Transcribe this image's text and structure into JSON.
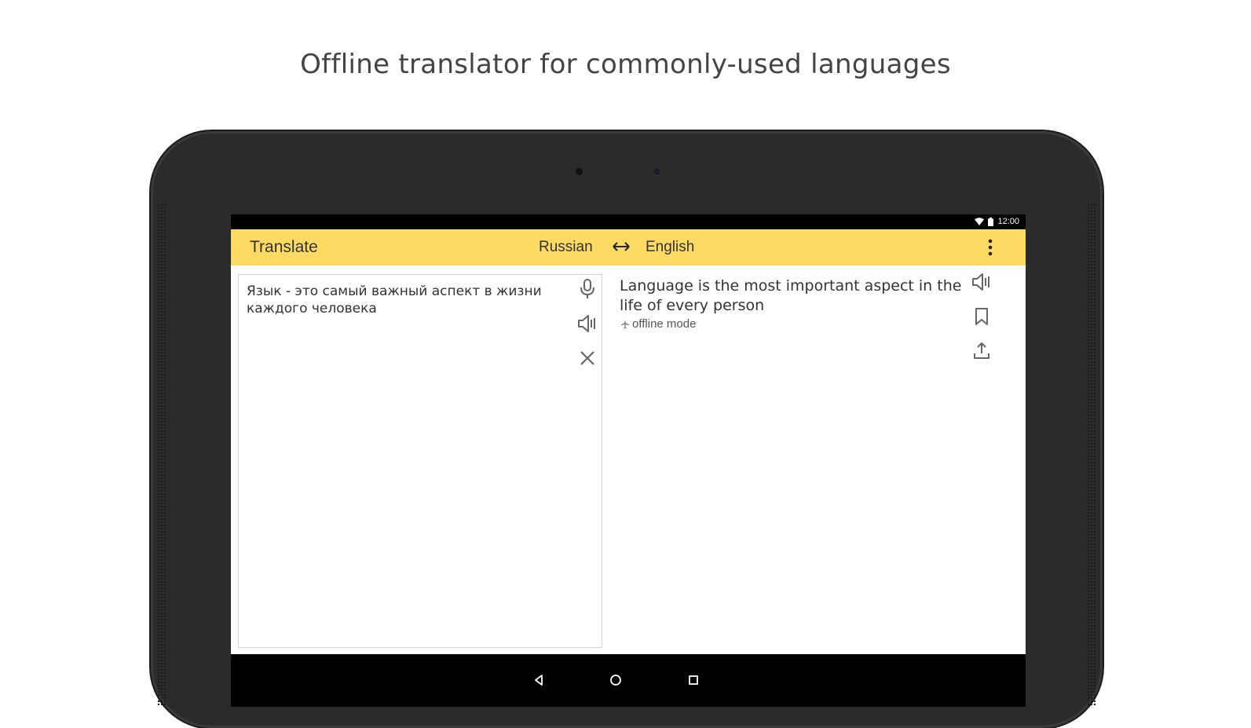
{
  "headline": "Offline translator for commonly-used languages",
  "status_bar": {
    "time": "12:00",
    "wifi_icon": "wifi-icon",
    "battery_icon": "battery-icon"
  },
  "toolbar": {
    "title": "Translate",
    "source_language": "Russian",
    "target_language": "English",
    "swap_icon": "swap-arrows-icon",
    "menu_icon": "overflow-menu-icon",
    "background_color": "#fddb63"
  },
  "input": {
    "text": "Язык - это самый важный аспект в жизни каждого человека",
    "icons": [
      "microphone-icon",
      "speaker-icon",
      "close-icon"
    ]
  },
  "output": {
    "text": "Language is the most important aspect in the life of every person",
    "mode_label": "offline mode",
    "icons": [
      "speaker-icon",
      "bookmark-icon",
      "share-icon"
    ]
  },
  "navigation": {
    "icons": [
      "back-icon",
      "home-icon",
      "recents-icon"
    ]
  }
}
